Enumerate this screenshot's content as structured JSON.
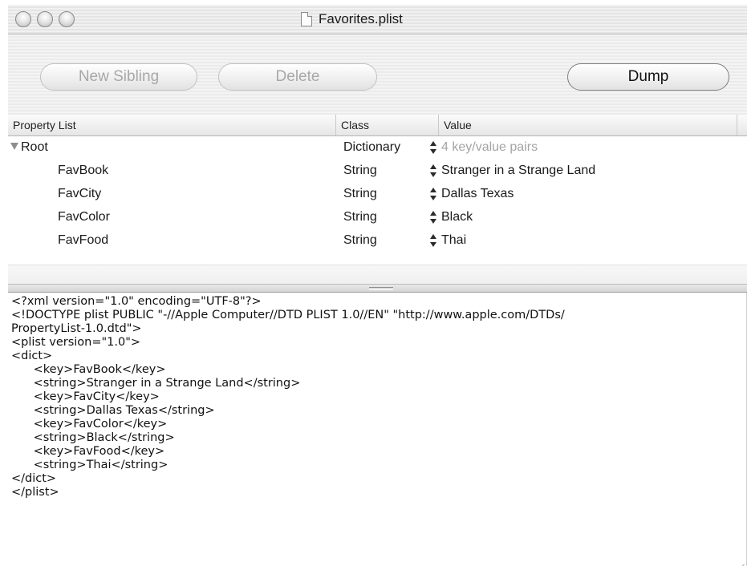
{
  "window": {
    "title": "Favorites.plist"
  },
  "toolbar": {
    "new_sibling_label": "New Sibling",
    "delete_label": "Delete",
    "dump_label": "Dump"
  },
  "table": {
    "headers": {
      "property": "Property List",
      "class": "Class",
      "value": "Value"
    },
    "rows": [
      {
        "key": "Root",
        "class": "Dictionary",
        "value": "4 key/value pairs"
      },
      {
        "key": "FavBook",
        "class": "String",
        "value": "Stranger in a Strange Land"
      },
      {
        "key": "FavCity",
        "class": "String",
        "value": "Dallas Texas"
      },
      {
        "key": "FavColor",
        "class": "String",
        "value": "Black"
      },
      {
        "key": "FavFood",
        "class": "String",
        "value": "Thai"
      }
    ]
  },
  "xml": {
    "lines": [
      "<?xml version=\"1.0\" encoding=\"UTF-8\"?>",
      "<!DOCTYPE plist PUBLIC \"-//Apple Computer//DTD PLIST 1.0//EN\" \"http://www.apple.com/DTDs/",
      "PropertyList-1.0.dtd\">",
      "<plist version=\"1.0\">",
      "<dict>",
      "      <key>FavBook</key>",
      "      <string>Stranger in a Strange Land</string>",
      "      <key>FavCity</key>",
      "      <string>Dallas Texas</string>",
      "      <key>FavColor</key>",
      "      <string>Black</string>",
      "      <key>FavFood</key>",
      "      <string>Thai</string>",
      "</dict>",
      "</plist>"
    ]
  }
}
